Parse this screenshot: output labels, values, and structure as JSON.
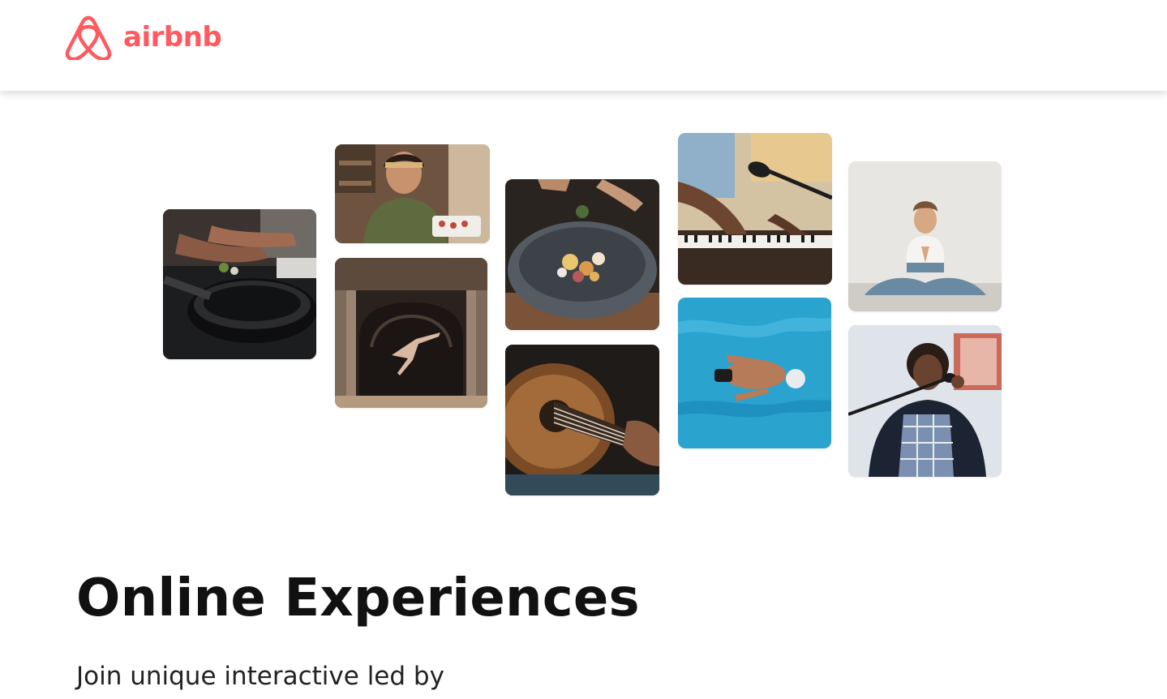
{
  "header": {
    "logo_text": "airbnb",
    "brand_color": "#FF5A5F"
  },
  "hero": {
    "photos": [
      {
        "name": "photo-cooking-pan",
        "subject": "hands cooking over a frying pan"
      },
      {
        "name": "photo-chef-woman",
        "subject": "smiling woman in a kitchen holding a tray"
      },
      {
        "name": "photo-dancer",
        "subject": "dancer leaping in an ornate doorway"
      },
      {
        "name": "photo-food-bowl",
        "subject": "plated food bowl being garnished"
      },
      {
        "name": "photo-guitar",
        "subject": "close-up of hands playing an acoustic guitar"
      },
      {
        "name": "photo-keyboard-mic",
        "subject": "hands on a keyboard next to a microphone"
      },
      {
        "name": "photo-swimmer",
        "subject": "swimmer in a blue pool seen from above"
      },
      {
        "name": "photo-yoga",
        "subject": "woman meditating in a yoga pose"
      },
      {
        "name": "photo-singer",
        "subject": "singer performing at a microphone"
      }
    ]
  },
  "main": {
    "title": "Online Experiences",
    "subtitle": "Join unique interactive led by"
  }
}
